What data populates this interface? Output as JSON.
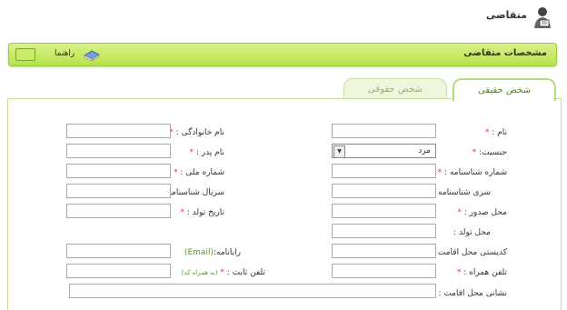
{
  "header": {
    "title": "متقاضی"
  },
  "section": {
    "title": "مشخصات متقاضی",
    "help_label": "راهنما"
  },
  "tabs": [
    {
      "label": "شخص حقیقی"
    },
    {
      "label": "شخص حقوقی"
    }
  ],
  "form": {
    "right": {
      "first_name": "نام :",
      "gender": "جنسیت:",
      "id_number": "شماره شناسنامه :",
      "id_series": "سری شناسنامه :",
      "issue_place": "محل صدور :",
      "birth_place": "محل تولد :",
      "postal_code": "کدپستی محل اقامت :",
      "mobile": "تلفن همراه :",
      "address": "نشانی محل اقامت :"
    },
    "left": {
      "last_name": "نام خانوادگی :",
      "father_name": "نام پدر :",
      "national_id": "شماره ملی :",
      "id_serial": "سریال شناسنامه :",
      "birth_date": "تاریخ تولد :",
      "email_prefix": "رایانامه:",
      "email_tag": "(Email)",
      "phone": "تلفن ثابت :",
      "phone_hint": "(به همراه کد)"
    },
    "required_mark": "*",
    "gender_value": "مرد"
  }
}
